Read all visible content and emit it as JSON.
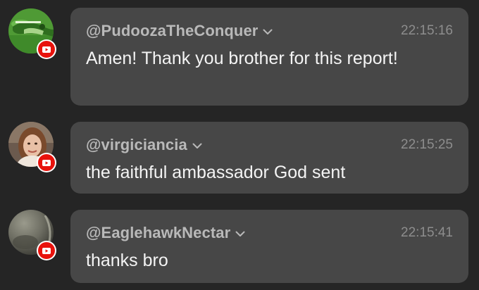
{
  "messages": [
    {
      "username": "@PudoozaTheConquer",
      "time": "22:15:16",
      "text": "Amen! Thank you brother for this report!",
      "avatar_icon": "green-landscape-avatar",
      "badge_icon": "youtube-icon"
    },
    {
      "username": "@virgiciancia",
      "time": "22:15:25",
      "text": "the faithful ambassador God sent",
      "avatar_icon": "woman-portrait-avatar",
      "badge_icon": "youtube-icon"
    },
    {
      "username": "@EaglehawkNectar",
      "time": "22:15:41",
      "text": "thanks bro",
      "avatar_icon": "gray-sphere-avatar",
      "badge_icon": "youtube-icon"
    }
  ],
  "colors": {
    "background": "#252525",
    "bubble": "#474747",
    "username": "#b9b9b9",
    "timestamp": "#8d8d8d",
    "text": "#f4f4f4",
    "youtube_red": "#e8120c"
  }
}
